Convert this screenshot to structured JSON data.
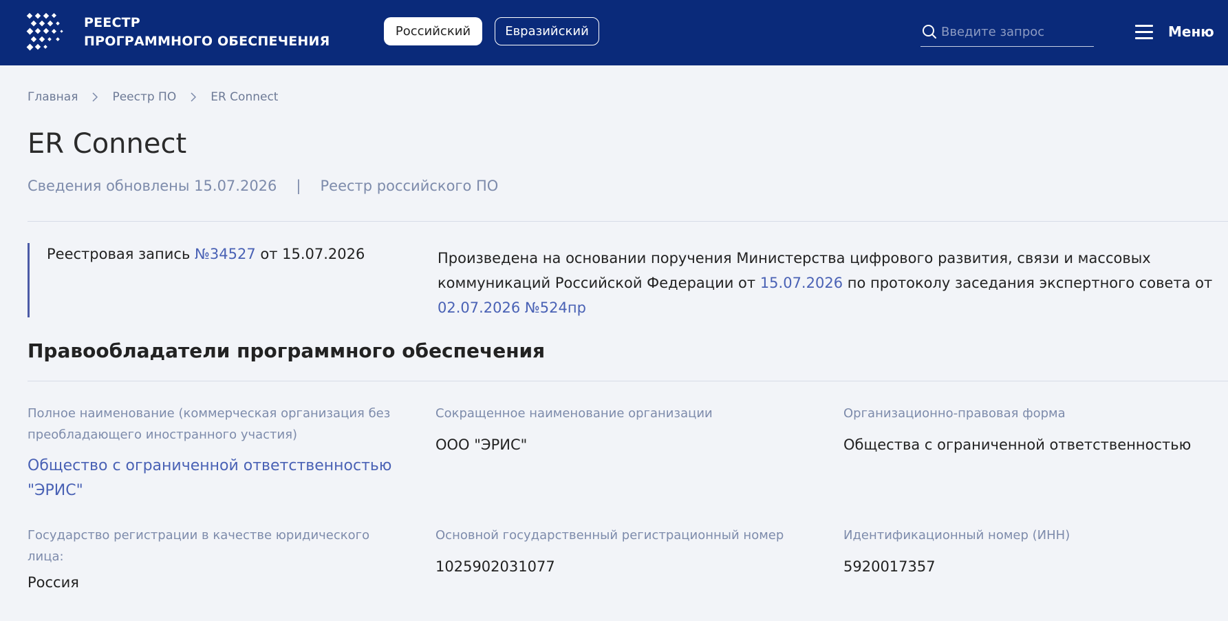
{
  "header": {
    "brand_line1": "РЕЕСТР",
    "brand_line2": "ПРОГРАММНОГО ОБЕСПЕЧЕНИЯ",
    "tab_russian": "Российский",
    "tab_eurasian": "Евразийский",
    "search_placeholder": "Введите запрос",
    "menu_label": "Меню"
  },
  "breadcrumb": {
    "items": [
      "Главная",
      "Реестр ПО",
      "ER Connect"
    ]
  },
  "page": {
    "title": "ER Connect",
    "updated": "Сведения обновлены 15.07.2026",
    "separator": "|",
    "registry": "Реестр российского ПО"
  },
  "record": {
    "prefix": "Реестровая запись ",
    "number": "№34527",
    "date_text": " от 15.07.2026",
    "basis_text1": "Произведена на основании поручения Министерства цифрового развития, связи и массовых коммуникаций Российской Федерации от ",
    "basis_date": "15.07.2026",
    "basis_text2": " по протоколу заседания экспертного совета от ",
    "protocol": "02.07.2026 №524пр"
  },
  "owners": {
    "section_title": "Правообладатели программного обеспечения",
    "full_name_label": "Полное наименование (коммерческая организация без преобладающего иностранного участия)",
    "full_name_value": "Общество с ограниченной ответственностью \"ЭРИС\"",
    "short_name_label": "Сокращенное наименование организации",
    "short_name_value": "ООО \"ЭРИС\"",
    "legal_form_label": "Организационно-правовая форма",
    "legal_form_value": "Общества с ограниченной ответственностью",
    "country_label": "Государство регистрации в качестве юридического лица:",
    "country_value": "Россия",
    "ogrn_label": "Основной государственный регистрационный номер",
    "ogrn_value": "1025902031077",
    "inn_label": "Идентификационный номер (ИНН)",
    "inn_value": "5920017357"
  },
  "colors": {
    "header_bg": "#0a2a7a",
    "page_bg": "#f2f4f8",
    "link": "#4a62b5",
    "muted": "#7d8bab"
  },
  "icons": [
    "logo-icon",
    "search-icon",
    "menu-icon",
    "chevron-right-icon"
  ]
}
